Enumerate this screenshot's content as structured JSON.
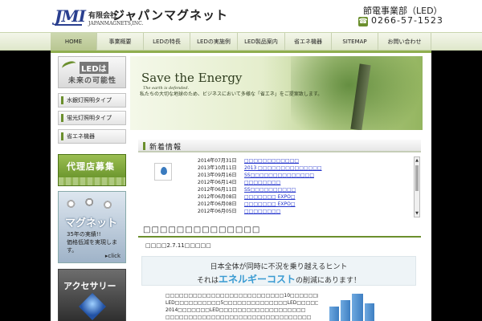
{
  "header": {
    "logo_mark": "JMI",
    "logo_kaisha": "有限会社",
    "logo_name": "ジャパンマグネット",
    "logo_en": "JAPANMAGNETS,INC.",
    "dept": "節電事業部（LED）",
    "phone": "0266-57-1523"
  },
  "nav": {
    "items": [
      {
        "label": "HOME",
        "active": true
      },
      {
        "label": "事業概要"
      },
      {
        "label": "LEDの特長"
      },
      {
        "label": "LEDの実施例"
      },
      {
        "label": "LED製品案内"
      },
      {
        "label": "省エネ機器"
      },
      {
        "label": "SITEMAP"
      },
      {
        "label": "お問い合わせ"
      }
    ]
  },
  "sidebar": {
    "led_banner_line1": "LEDは",
    "led_banner_line2": "未来の可能性",
    "menu": [
      "水銀灯照明タイプ",
      "蛍光灯照明タイプ",
      "省エネ機器"
    ],
    "agent_label": "代理店募集",
    "magnet_title": "マグネット",
    "magnet_sub1": "35年の実績!!",
    "magnet_sub2": "価格低減を実現します。",
    "magnet_click": "▸click",
    "accessory_title": "アクセサリー"
  },
  "hero": {
    "title": "Save the Energy",
    "subtitle": "The earth is defended.",
    "desc": "私たちの大切な地球のため、ビジネスにおいて多様な「省エネ」をご提案致します。"
  },
  "news": {
    "heading": "新着情報",
    "items": [
      {
        "date": "2014年07月31日",
        "text": "□□□□□□□□□□□□"
      },
      {
        "date": "2013年10月11日",
        "text": "2013 □□□□□□□□□□□□□□"
      },
      {
        "date": "2013年09月16日",
        "text": "SS□□□□□□□□□□□□□□"
      },
      {
        "date": "2012年06月14日",
        "text": "□□□□□□□□"
      },
      {
        "date": "2012年06月11日",
        "text": "SS□□□□□□□□□□"
      },
      {
        "date": "2012年06月08日",
        "text": "□□□□□□□ EXPO□"
      },
      {
        "date": "2012年06月08日",
        "text": "□□□□□□□ EXPO□"
      },
      {
        "date": "2012年06月05日",
        "text": "□□□□□□□□"
      }
    ]
  },
  "section": {
    "title": "□□□□□□□□□□□□□□",
    "updated": "□□□□2.7.11□□□□□",
    "catch_line1": "日本全体が同時に不況を乗り越えるヒント",
    "catch_pre": "それは",
    "catch_highlight": "エネルギーコスト",
    "catch_post": "の削減にあります！",
    "body": [
      "□□□□□□□□□□□□□□□□□□□□□□□□□□10□□□□□□□□",
      "LED□□□□□□□□□□5□□□□□□□□□□□□□□LED□□□□□□□",
      "2014□□□□□□□LED□□□□□□□□□□□□□□□□□□□",
      "□□□□□□□□□□□□□□□□□□□□□□□□□□□□□□□□"
    ]
  },
  "colors": {
    "accent_green": "#6b8f2d",
    "link_blue": "#2233cc",
    "catch_blue": "#3a9bd2"
  }
}
